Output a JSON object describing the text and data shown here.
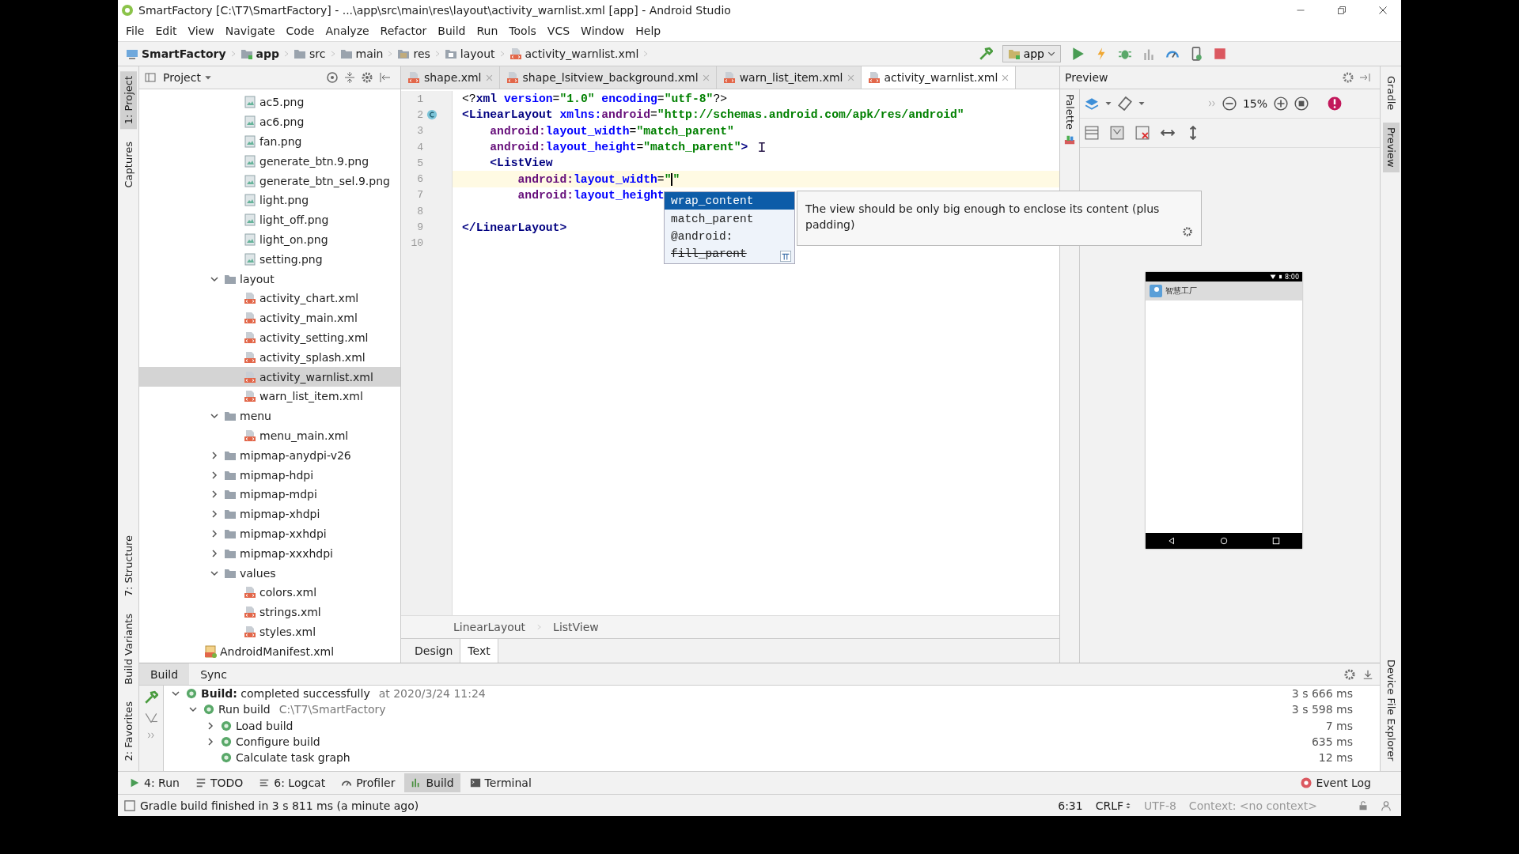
{
  "window": {
    "title": "SmartFactory [C:\\T7\\SmartFactory] - ...\\app\\src\\main\\res\\layout\\activity_warnlist.xml [app] - Android Studio"
  },
  "menu": [
    "File",
    "Edit",
    "View",
    "Navigate",
    "Code",
    "Analyze",
    "Refactor",
    "Build",
    "Run",
    "Tools",
    "VCS",
    "Window",
    "Help"
  ],
  "breadcrumbs": [
    {
      "label": "SmartFactory",
      "kind": "project"
    },
    {
      "label": "app",
      "kind": "module"
    },
    {
      "label": "src",
      "kind": "folder"
    },
    {
      "label": "main",
      "kind": "folder"
    },
    {
      "label": "res",
      "kind": "res"
    },
    {
      "label": "layout",
      "kind": "layout"
    },
    {
      "label": "activity_warnlist.xml",
      "kind": "xml"
    }
  ],
  "run_config": "app",
  "left_strip_top": [
    {
      "label": "1: Project",
      "selected": true
    },
    {
      "label": "Captures",
      "selected": false
    }
  ],
  "left_strip_bottom": [
    {
      "label": "7: Structure",
      "selected": false
    },
    {
      "label": "Build Variants",
      "selected": false
    },
    {
      "label": "2: Favorites",
      "selected": false
    }
  ],
  "right_strip_top": [
    {
      "label": "Gradle",
      "selected": false
    },
    {
      "label": "Preview",
      "selected": true
    }
  ],
  "right_strip_bottom": [
    {
      "label": "Device File Explorer",
      "selected": false
    }
  ],
  "project_panel": {
    "title": "Project",
    "tree": [
      {
        "kind": "offscreen",
        "children": [
          {
            "kind": "offscreen",
            "children": [
              {
                "kind": "image",
                "label": "ac5.png",
                "selected": false
              },
              {
                "kind": "image",
                "label": "ac6.png",
                "selected": false
              },
              {
                "kind": "image",
                "label": "fan.png",
                "selected": false
              },
              {
                "kind": "image",
                "label": "generate_btn.9.png",
                "selected": false
              },
              {
                "kind": "image",
                "label": "generate_btn_sel.9.png",
                "selected": false
              },
              {
                "kind": "image",
                "label": "light.png",
                "selected": false
              },
              {
                "kind": "image",
                "label": "light_off.png",
                "selected": false
              },
              {
                "kind": "image",
                "label": "light_on.png",
                "selected": false
              },
              {
                "kind": "image",
                "label": "setting.png",
                "selected": false
              }
            ]
          },
          {
            "kind": "folder",
            "label": "layout",
            "expanded": true,
            "children": [
              {
                "kind": "xml",
                "label": "activity_chart.xml",
                "selected": false
              },
              {
                "kind": "xml",
                "label": "activity_main.xml",
                "selected": false
              },
              {
                "kind": "xml",
                "label": "activity_setting.xml",
                "selected": false
              },
              {
                "kind": "xml",
                "label": "activity_splash.xml",
                "selected": false
              },
              {
                "kind": "xml",
                "label": "activity_warnlist.xml",
                "selected": true
              },
              {
                "kind": "xml",
                "label": "warn_list_item.xml",
                "selected": false
              }
            ]
          },
          {
            "kind": "folder",
            "label": "menu",
            "expanded": true,
            "children": [
              {
                "kind": "xml",
                "label": "menu_main.xml",
                "selected": false
              }
            ]
          },
          {
            "kind": "folder",
            "label": "mipmap-anydpi-v26",
            "expanded": false
          },
          {
            "kind": "folder",
            "label": "mipmap-hdpi",
            "expanded": false
          },
          {
            "kind": "folder",
            "label": "mipmap-mdpi",
            "expanded": false
          },
          {
            "kind": "folder",
            "label": "mipmap-xhdpi",
            "expanded": false
          },
          {
            "kind": "folder",
            "label": "mipmap-xxhdpi",
            "expanded": false
          },
          {
            "kind": "folder",
            "label": "mipmap-xxxhdpi",
            "expanded": false
          },
          {
            "kind": "folder",
            "label": "values",
            "expanded": true,
            "children": [
              {
                "kind": "xml",
                "label": "colors.xml",
                "selected": false
              },
              {
                "kind": "xml",
                "label": "strings.xml",
                "selected": false
              },
              {
                "kind": "xml",
                "label": "styles.xml",
                "selected": false
              }
            ]
          }
        ]
      },
      {
        "kind": "manifest",
        "label": "AndroidManifest.xml",
        "selected": false
      }
    ]
  },
  "editor_tabs": [
    {
      "label": "shape.xml",
      "selected": false
    },
    {
      "label": "shape_lsitview_background.xml",
      "selected": false
    },
    {
      "label": "warn_list_item.xml",
      "selected": false
    },
    {
      "label": "activity_warnlist.xml",
      "selected": true
    }
  ],
  "code": [
    {
      "number": "1",
      "current": false,
      "tokens": [
        {
          "kind": "punct",
          "text": "<?"
        },
        {
          "kind": "tag",
          "text": "xml"
        },
        {
          "kind": "attr",
          "text": " version"
        },
        {
          "kind": "punct",
          "text": "="
        },
        {
          "kind": "value",
          "text": "\"1.0\""
        },
        {
          "kind": "attr",
          "text": " encoding"
        },
        {
          "kind": "punct",
          "text": "="
        },
        {
          "kind": "value",
          "text": "\"utf-8\""
        },
        {
          "kind": "punct",
          "text": "?>"
        }
      ]
    },
    {
      "number": "2",
      "current": false,
      "tokens": [
        {
          "kind": "tag",
          "text": "<LinearLayout"
        },
        {
          "kind": "attr",
          "text": " xmlns:"
        },
        {
          "kind": "ns",
          "text": "android"
        },
        {
          "kind": "punct",
          "text": "="
        },
        {
          "kind": "value",
          "text": "\"http://schemas.android.com/apk/res/android\""
        }
      ]
    },
    {
      "number": "3",
      "current": false,
      "tokens": [
        {
          "kind": "ns",
          "text": "    android:"
        },
        {
          "kind": "attr",
          "text": "layout_width"
        },
        {
          "kind": "punct",
          "text": "="
        },
        {
          "kind": "value",
          "text": "\"match_parent\""
        }
      ]
    },
    {
      "number": "4",
      "current": false,
      "tokens": [
        {
          "kind": "ns",
          "text": "    android:"
        },
        {
          "kind": "attr",
          "text": "layout_height"
        },
        {
          "kind": "punct",
          "text": "="
        },
        {
          "kind": "value",
          "text": "\"match_parent\""
        },
        {
          "kind": "tag",
          "text": ">"
        }
      ]
    },
    {
      "number": "5",
      "current": false,
      "tokens": [
        {
          "kind": "tag",
          "text": "    <ListView"
        }
      ]
    },
    {
      "number": "6",
      "current": true,
      "tokens": [
        {
          "kind": "ns",
          "text": "        android:"
        },
        {
          "kind": "attr",
          "text": "layout_width"
        },
        {
          "kind": "punct",
          "text": "="
        },
        {
          "kind": "value",
          "text": "\""
        },
        {
          "kind": "caret"
        },
        {
          "kind": "value",
          "text": "\""
        }
      ]
    },
    {
      "number": "7",
      "current": false,
      "tokens": [
        {
          "kind": "ns",
          "text": "        android:"
        },
        {
          "kind": "attr",
          "text": "layout_height"
        }
      ]
    },
    {
      "number": "8",
      "current": false
    },
    {
      "number": "9",
      "current": false,
      "tokens": [
        {
          "kind": "tag",
          "text": "</LinearLayout>"
        }
      ]
    },
    {
      "number": "10",
      "current": false
    }
  ],
  "completion": {
    "items": [
      {
        "label": "wrap_content",
        "selected": true,
        "deprecated": false
      },
      {
        "label": "match_parent",
        "selected": false,
        "deprecated": false
      },
      {
        "label": "@android:",
        "selected": false,
        "deprecated": false
      },
      {
        "label": "fill_parent",
        "selected": false,
        "deprecated": true
      }
    ],
    "doc": "The view should be only big enough to enclose its content (plus padding)"
  },
  "editor_breadcrumbs": [
    "LinearLayout",
    "ListView"
  ],
  "editor_mode_tabs": [
    {
      "label": "Design",
      "selected": false
    },
    {
      "label": "Text",
      "selected": true
    }
  ],
  "preview": {
    "title": "Preview",
    "palette": "Palette",
    "zoom": "15%",
    "phone": {
      "time": "8:00",
      "app_title": "智慧工厂"
    }
  },
  "build_panel": {
    "tabs": [
      {
        "label": "Build",
        "selected": true
      },
      {
        "label": "Sync",
        "selected": false
      }
    ],
    "tree": [
      {
        "label": "**Build:** completed successfully",
        "detail": "at 2020/3/24 11:24",
        "time": "3 s 666 ms",
        "expanded": true,
        "children": [
          {
            "label": "Run build",
            "detail": "C:\\T7\\SmartFactory",
            "time": "3 s 598 ms",
            "expanded": true,
            "children": [
              {
                "label": "Load build",
                "time": "7 ms",
                "expanded": false
              },
              {
                "label": "Configure build",
                "time": "635 ms",
                "expanded": false
              },
              {
                "label": "Calculate task graph",
                "time": "12 ms"
              }
            ]
          }
        ]
      }
    ]
  },
  "tool_windows": [
    {
      "label": "4: Run",
      "kind": "run",
      "selected": false
    },
    {
      "label": "TODO",
      "kind": "todo",
      "selected": false
    },
    {
      "label": "6: Logcat",
      "kind": "logcat",
      "selected": false
    },
    {
      "label": "Profiler",
      "kind": "profiler",
      "selected": false
    },
    {
      "label": "Build",
      "kind": "build",
      "selected": true
    },
    {
      "label": "Terminal",
      "kind": "terminal",
      "selected": false
    }
  ],
  "event_log": {
    "label": "Event Log"
  },
  "status_bar": {
    "message": "Gradle build finished in 3 s 811 ms (a minute ago)",
    "position": "6:31",
    "line_separator": "CRLF",
    "encoding": "UTF-8",
    "context": "Context: <no context>"
  }
}
